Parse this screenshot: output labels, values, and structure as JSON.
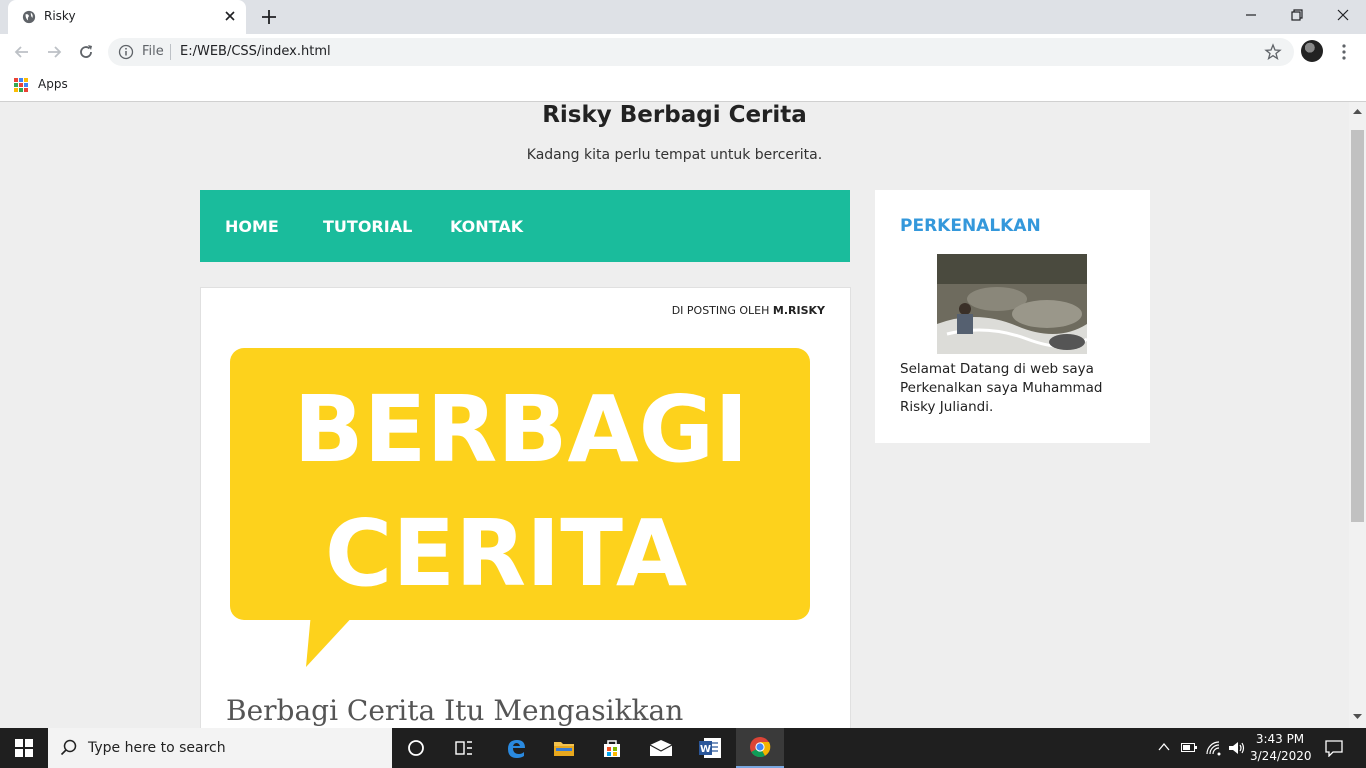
{
  "browser": {
    "tab_title": "Risky",
    "omnibox_scheme": "File",
    "omnibox_url": "E:/WEB/CSS/index.html",
    "bookmark_apps": "Apps"
  },
  "page": {
    "site_title": "Risky Berbagi Cerita",
    "site_subtitle": "Kadang kita perlu tempat untuk bercerita.",
    "nav": {
      "items": [
        {
          "label": "HOME"
        },
        {
          "label": "TUTORIAL"
        },
        {
          "label": "KONTAK"
        }
      ],
      "color": "#1abc9c"
    },
    "post": {
      "byline_prefix": "DI POSTING OLEH ",
      "byline_author": "M.RISKY",
      "hero_line1": "BERBAGI",
      "hero_line2": "CERITA",
      "hero_color": "#fdd21c",
      "title": "Berbagi Cerita Itu Mengasikkan"
    },
    "sidebar": {
      "widget_title": "PERKENALKAN",
      "widget_title_color": "#3498db",
      "intro": "Selamat Datang di web saya Perkenalkan saya Muhammad Risky Juliandi."
    }
  },
  "taskbar": {
    "search_placeholder": "Type here to search",
    "time": "3:43 PM",
    "date": "3/24/2020"
  }
}
